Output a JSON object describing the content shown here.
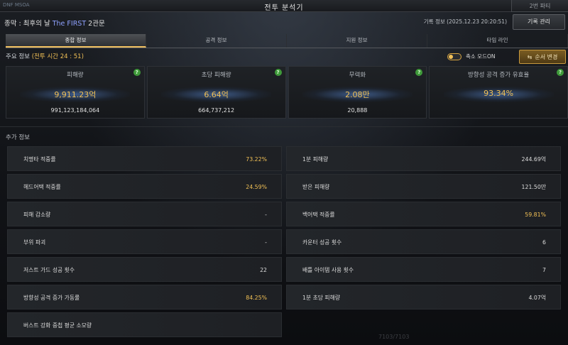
{
  "window": {
    "title": "전투 분석기",
    "corner_text": "DNF MSOA",
    "party_tab": "2번 파티"
  },
  "header": {
    "boss_prefix": "종막 : 최후의 날",
    "boss_highlight": "The FIRST",
    "boss_suffix": "2관문",
    "record_info": "기록 정보 (2025.12.23 20:20:51)",
    "record_button": "기록 관리"
  },
  "tabs": [
    {
      "label": "종합 정보",
      "active": true
    },
    {
      "label": "공격 정보",
      "active": false
    },
    {
      "label": "지원 정보",
      "active": false
    },
    {
      "label": "타임 라인",
      "active": false
    }
  ],
  "main": {
    "label": "주요 정보",
    "combat_time": "(전투 시간 24 : 51)",
    "compact_mode_label": "축소 모드ON",
    "compact_mode_on": true,
    "order_button": "순서 변경"
  },
  "stats": [
    {
      "title": "피해량",
      "value": "9,911.23억",
      "sub": "991,123,184,064"
    },
    {
      "title": "초당 피해량",
      "value": "6.64억",
      "sub": "664,737,212"
    },
    {
      "title": "무력화",
      "value": "2.08만",
      "sub": "20,888"
    },
    {
      "title": "방향성 공격 증가 유효율",
      "value": "93.34%",
      "sub": ""
    }
  ],
  "extra": {
    "label": "추가 정보",
    "left": [
      {
        "label": "치명타 적중률",
        "value": "73.22%",
        "gold": true
      },
      {
        "label": "헤드어택 적중률",
        "value": "24.59%",
        "gold": true
      },
      {
        "label": "피해 감소량",
        "value": "-",
        "gold": false
      },
      {
        "label": "부위 파괴",
        "value": "-",
        "gold": false
      },
      {
        "label": "저스트 가드 성공 횟수",
        "value": "22",
        "gold": false
      },
      {
        "label": "방향성 공격 증가 가동률",
        "value": "84.25%",
        "gold": true
      },
      {
        "label": "버스트 강화 중첩 평균 소모량",
        "value": "",
        "gold": false
      }
    ],
    "right": [
      {
        "label": "1분 피해량",
        "value": "244.69억",
        "gold": false
      },
      {
        "label": "받은 피해량",
        "value": "121.50만",
        "gold": false
      },
      {
        "label": "백어택 적중률",
        "value": "59.81%",
        "gold": true
      },
      {
        "label": "카운터 성공 횟수",
        "value": "6",
        "gold": false
      },
      {
        "label": "배틀 아이템 사용 횟수",
        "value": "7",
        "gold": false
      },
      {
        "label": "1분 초당 피해량",
        "value": "4.07억",
        "gold": false
      }
    ]
  },
  "bottom_hint": "7103/7103"
}
